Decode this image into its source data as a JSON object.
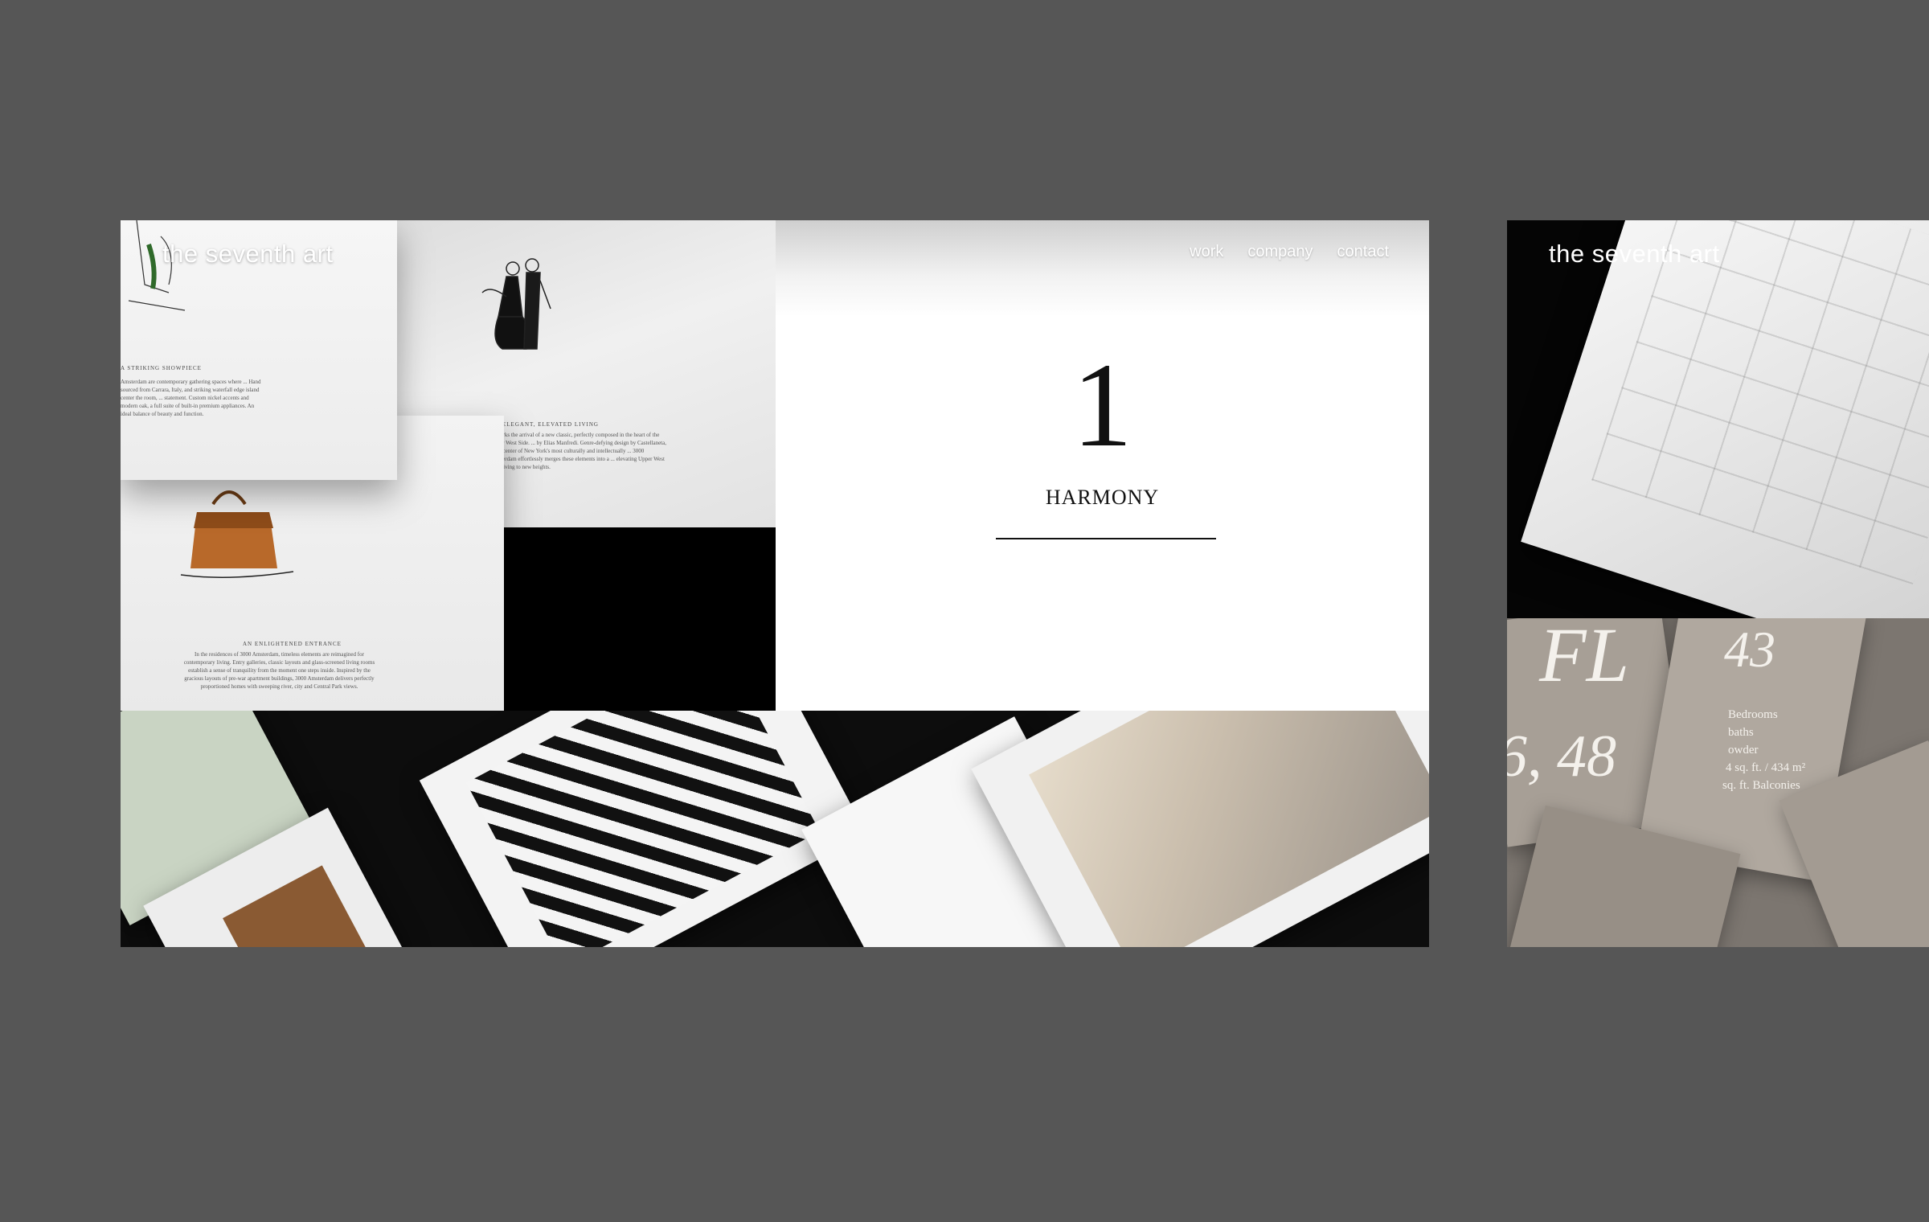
{
  "brand": {
    "name": "the seventh art"
  },
  "nav": {
    "items": [
      "work",
      "company",
      "contact"
    ]
  },
  "hero": {
    "chapter_number": "1",
    "chapter_title": "HARMONY"
  },
  "brochure": {
    "heading_a": "A STRIKING SHOWPIECE",
    "body_a": "Amsterdam are contemporary gathering spaces where ... Hand sourced from Carrara, Italy, and striking waterfall edge island center the room, ... statement. Custom nickel accents and modern oak, a full suite of built-in premium appliances. An ideal balance of beauty and function.",
    "heading_b": "ELEGANT, ELEVATED LIVING",
    "body_b": "... marks the arrival of a new classic, perfectly composed in the heart of the Upper West Side. ... by Elias Manfredi. Genre-defying design by Castellaneta, ... epicenter of New York's most culturally and intellectually ... 3000 Amsterdam effortlessly merges these elements into a ... elevating Upper West Side living to new heights.",
    "heading_c": "AN ENLIGHTENED ENTRANCE",
    "body_c": "In the residences of 3000 Amsterdam, timeless elements are reimagined for contemporary living. Entry galleries, classic layouts and glass-screened living rooms establish a sense of tranquility from the moment one steps inside. Inspired by the gracious layouts of pre-war apartment buildings, 3000 Amsterdam delivers perfectly proportioned homes with sweeping river, city and Central Park views."
  },
  "side": {
    "brand": "the seventh art",
    "floor_label": "FL",
    "floor_numbers": "43",
    "floors": "6, 48",
    "spec_lines": [
      "Bedrooms",
      "baths",
      "owder",
      "4 sq. ft. / 434 m²",
      "sq. ft. Balconies"
    ]
  },
  "colors": {
    "background": "#565656",
    "ink": "#111111",
    "nav_text": "#ffffff",
    "taupe": "#a79f96"
  }
}
